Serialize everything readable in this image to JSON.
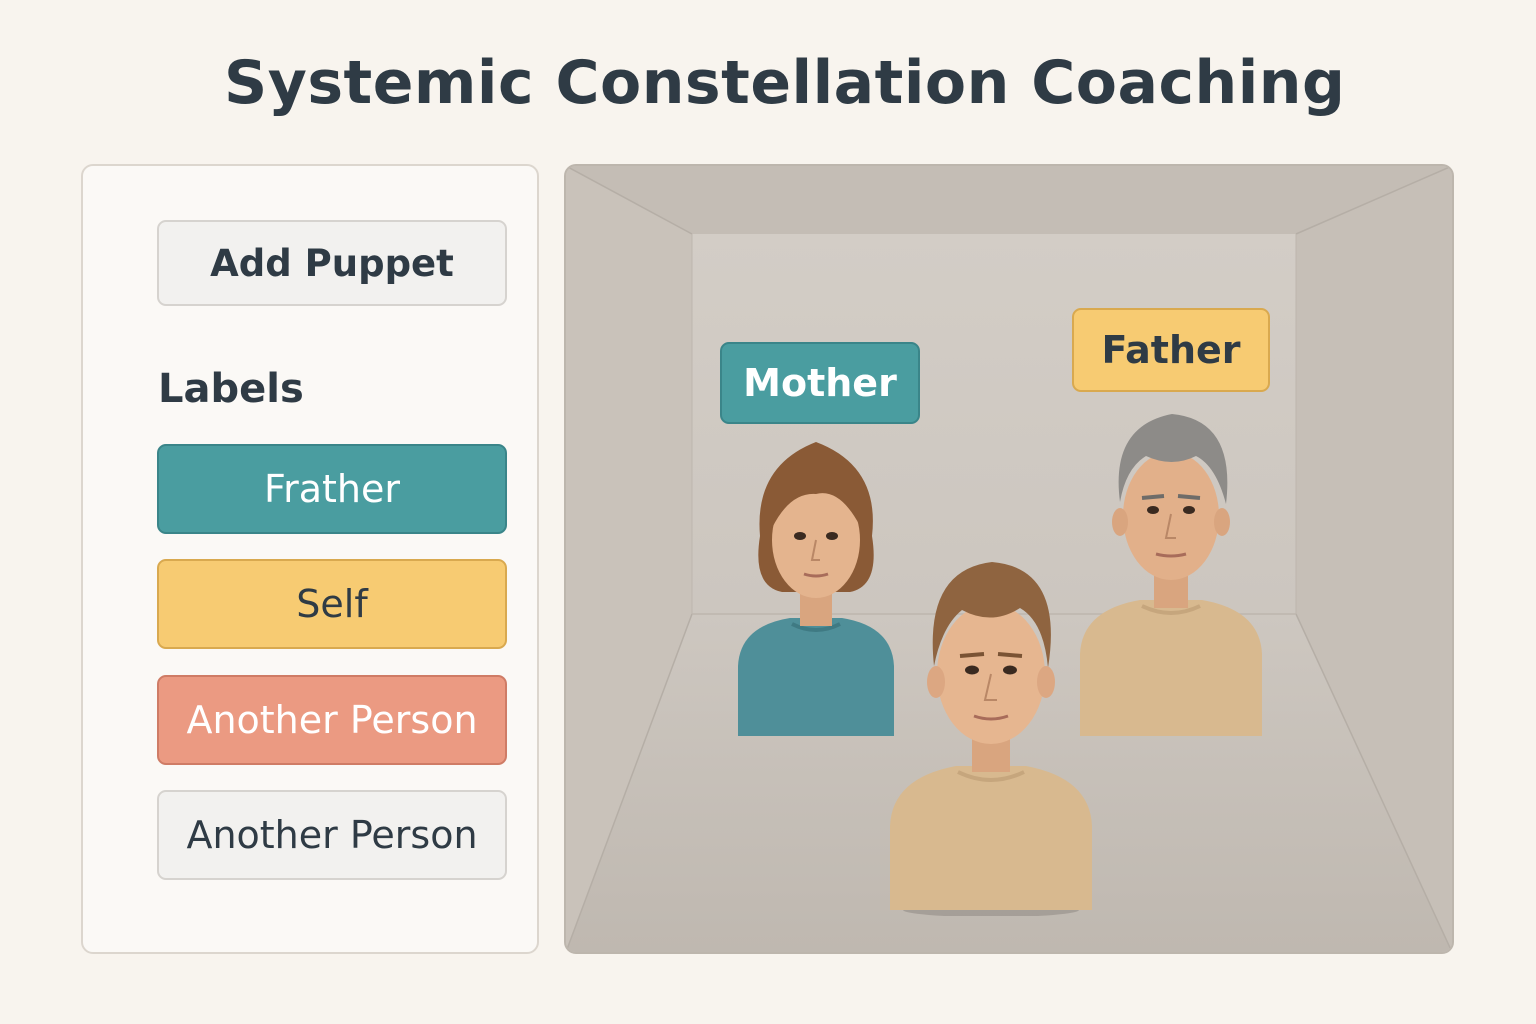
{
  "title": "Systemic Constellation Coaching",
  "sidebar": {
    "add_button": "Add Puppet",
    "labels_heading": "Labels",
    "labels": [
      {
        "text": "Frather",
        "color": "#4a9da0"
      },
      {
        "text": "Self",
        "color": "#f7cb72"
      },
      {
        "text": "Another Person",
        "color": "#eb9a82"
      },
      {
        "text": "Another Person",
        "color": "#f2f1ef"
      }
    ]
  },
  "stage": {
    "tags": [
      {
        "text": "Mother",
        "color": "#4a9da0"
      },
      {
        "text": "Father",
        "color": "#f7cb72"
      }
    ],
    "puppets": [
      {
        "name": "mother",
        "shirt_color": "#4f8f99",
        "hair_color": "#8a5a36"
      },
      {
        "name": "self",
        "shirt_color": "#d8b98f",
        "hair_color": "#8f6440"
      },
      {
        "name": "father",
        "shirt_color": "#d8b98f",
        "hair_color": "#8d8b88"
      }
    ]
  }
}
